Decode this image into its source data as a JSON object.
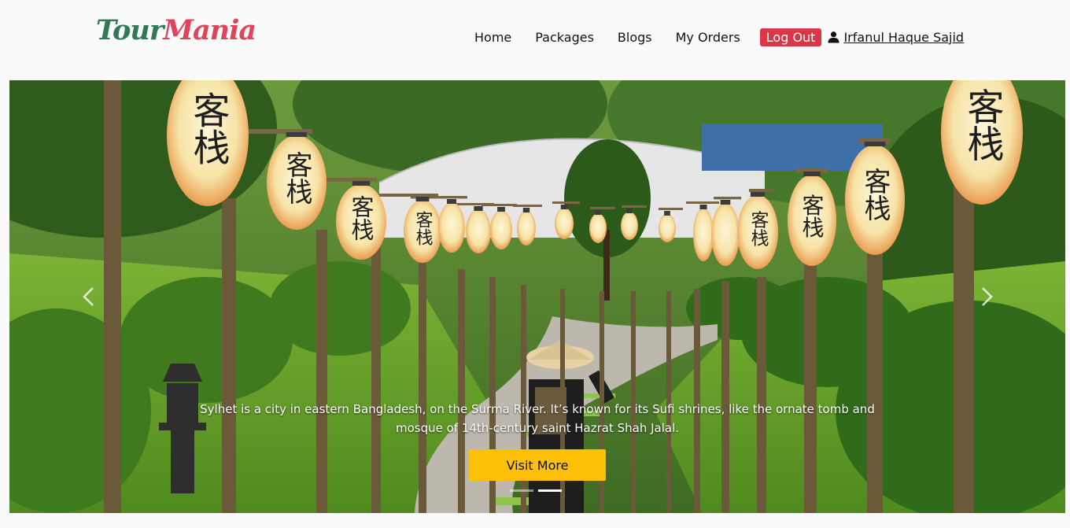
{
  "brand": {
    "part1": "Tour",
    "part2": "Mania"
  },
  "nav": {
    "items": [
      {
        "label": "Home"
      },
      {
        "label": "Packages"
      },
      {
        "label": "Blogs"
      },
      {
        "label": "My Orders"
      }
    ],
    "logout_label": "Log Out",
    "user_name": "Irfanul Haque Sajid",
    "user_icon": "user-icon"
  },
  "carousel": {
    "caption": "Sylhet is a city in eastern Bangladesh, on the Surma River. It’s known for its Sufi shrines, like the ornate tomb and mosque of 14th-century saint Hazrat Shah Jalal.",
    "button_label": "Visit More",
    "prev_icon": "chevron-left-icon",
    "next_icon": "chevron-right-icon",
    "slides_count": 2,
    "active_slide": 2,
    "lantern_text": "客栈"
  },
  "colors": {
    "logout": "#dc3545",
    "visit_button": "#ffc107",
    "brand_green": "#2f7a55",
    "brand_red": "#e0445c"
  }
}
